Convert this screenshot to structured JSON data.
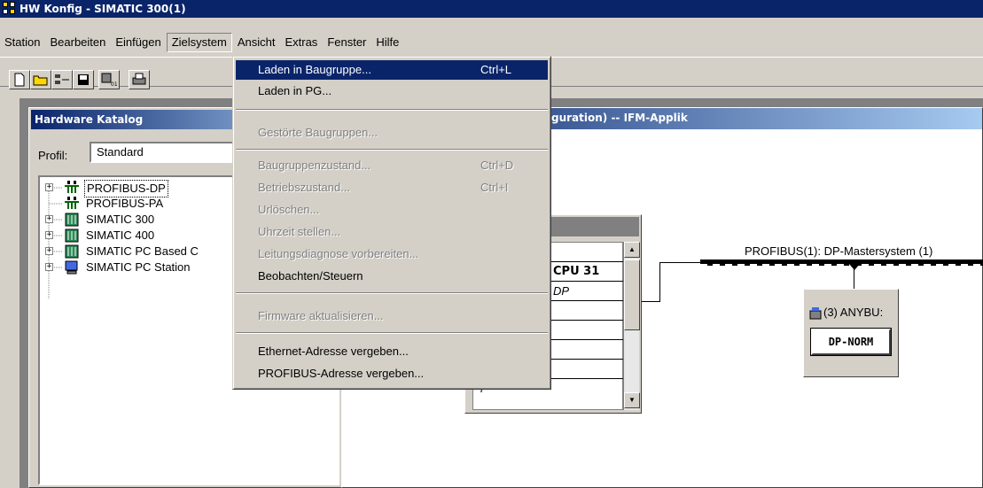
{
  "window": {
    "title": "HW Konfig - SIMATIC 300(1)"
  },
  "menubar": [
    "Station",
    "Bearbeiten",
    "Einfügen",
    "Zielsystem",
    "Ansicht",
    "Extras",
    "Fenster",
    "Hilfe"
  ],
  "dropdown": {
    "items": [
      {
        "label": "Laden in Baugruppe...",
        "shortcut": "Ctrl+L",
        "state": "highlighted"
      },
      {
        "label": "Laden in PG...",
        "shortcut": "",
        "state": "enabled"
      },
      {
        "label": "Gestörte Baugruppen...",
        "shortcut": "",
        "state": "disabled"
      },
      {
        "label": "Baugruppenzustand...",
        "shortcut": "Ctrl+D",
        "state": "disabled"
      },
      {
        "label": "Betriebszustand...",
        "shortcut": "Ctrl+I",
        "state": "disabled"
      },
      {
        "label": "Urlöschen...",
        "shortcut": "",
        "state": "disabled"
      },
      {
        "label": "Uhrzeit stellen...",
        "shortcut": "",
        "state": "disabled"
      },
      {
        "label": "Leitungsdiagnose vorbereiten...",
        "shortcut": "",
        "state": "disabled"
      },
      {
        "label": "Beobachten/Steuern",
        "shortcut": "",
        "state": "enabled"
      },
      {
        "label": "Firmware aktualisieren...",
        "shortcut": "",
        "state": "disabled"
      },
      {
        "label": "Ethernet-Adresse vergeben...",
        "shortcut": "",
        "state": "enabled"
      },
      {
        "label": "PROFIBUS-Adresse vergeben...",
        "shortcut": "",
        "state": "enabled"
      }
    ]
  },
  "catalog": {
    "title": "Hardware Katalog",
    "profile_label": "Profil:",
    "profile_value": "Standard",
    "tree": [
      {
        "label": "PROFIBUS-DP",
        "icon": "network-icon",
        "expandable": true
      },
      {
        "label": "PROFIBUS-PA",
        "icon": "network-icon",
        "expandable": false
      },
      {
        "label": "SIMATIC 300",
        "icon": "module-icon",
        "expandable": true
      },
      {
        "label": "SIMATIC 400",
        "icon": "module-icon",
        "expandable": true
      },
      {
        "label": "SIMATIC PC Based C",
        "icon": "module-icon",
        "expandable": true
      },
      {
        "label": "SIMATIC PC Station",
        "icon": "pc-icon",
        "expandable": true
      }
    ]
  },
  "station": {
    "title": "guration) -- IFM-Applik",
    "rack": {
      "cpu": "CPU 31",
      "dp": "DP",
      "last_slot": "7"
    },
    "bus_label": "PROFIBUS(1): DP-Mastersystem (1)",
    "slave_title": "(3) ANYBU:",
    "slave_module": "DP-NORM"
  },
  "colors": {
    "titlebar": "#0a246a",
    "highlight": "#0a246a",
    "face": "#d4d0c8"
  }
}
